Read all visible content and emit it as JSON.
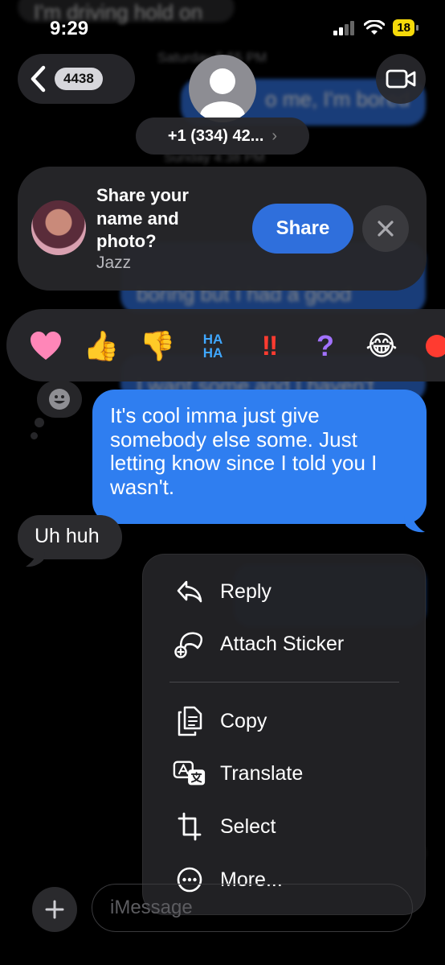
{
  "status_bar": {
    "time": "9:29",
    "battery": "18"
  },
  "header": {
    "unread_count": "4438",
    "contact_name": "+1 (334) 42...",
    "contact_chevron": "›"
  },
  "background": {
    "top_snippet": "I'm driving hold on",
    "timestamp_1": "Saturday 5:55 PM",
    "snippet_2": "o me, I'm bored",
    "timestamp_2": "Sunday 4:38 PM",
    "snippet_3": "boring but I had a good",
    "snippet_4": "I want some and I haven't"
  },
  "share_banner": {
    "title": "Share your name and photo?",
    "subtitle": "Jazz",
    "share_label": "Share"
  },
  "reactions": [
    {
      "name": "heart",
      "glyph": "❤",
      "color": "#ff7fb0"
    },
    {
      "name": "thumbs-up",
      "glyph": "👍",
      "color": "#f6c04a"
    },
    {
      "name": "thumbs-down",
      "glyph": "👎",
      "color": "#f6a23a"
    },
    {
      "name": "haha",
      "glyph": "HA HA",
      "color": "#3fa7ff"
    },
    {
      "name": "exclamation",
      "glyph": "‼",
      "color": "#ff3b30"
    },
    {
      "name": "question",
      "glyph": "?",
      "color": "#a272ff"
    },
    {
      "name": "laughing",
      "glyph": "😂",
      "color": "#f6c04a"
    },
    {
      "name": "more",
      "glyph": "",
      "color": "#ff3b30"
    }
  ],
  "messages": {
    "sent": "It's cool imma just give somebody else some. Just letting know since I told you I wasn't.",
    "received": "Uh huh"
  },
  "context_menu": {
    "items": [
      {
        "label": "Reply",
        "icon": "reply-icon"
      },
      {
        "label": "Attach Sticker",
        "icon": "sticker-icon"
      },
      {
        "label": "Copy",
        "icon": "copy-icon"
      },
      {
        "label": "Translate",
        "icon": "translate-icon"
      },
      {
        "label": "Select",
        "icon": "crop-select-icon"
      },
      {
        "label": "More...",
        "icon": "ellipsis-circle-icon"
      }
    ]
  },
  "input_bar": {
    "placeholder": "iMessage"
  },
  "colors": {
    "accent_blue": "#2f7ef0",
    "banner_blue": "#2f6fdc",
    "battery_yellow": "#f5d90a"
  }
}
